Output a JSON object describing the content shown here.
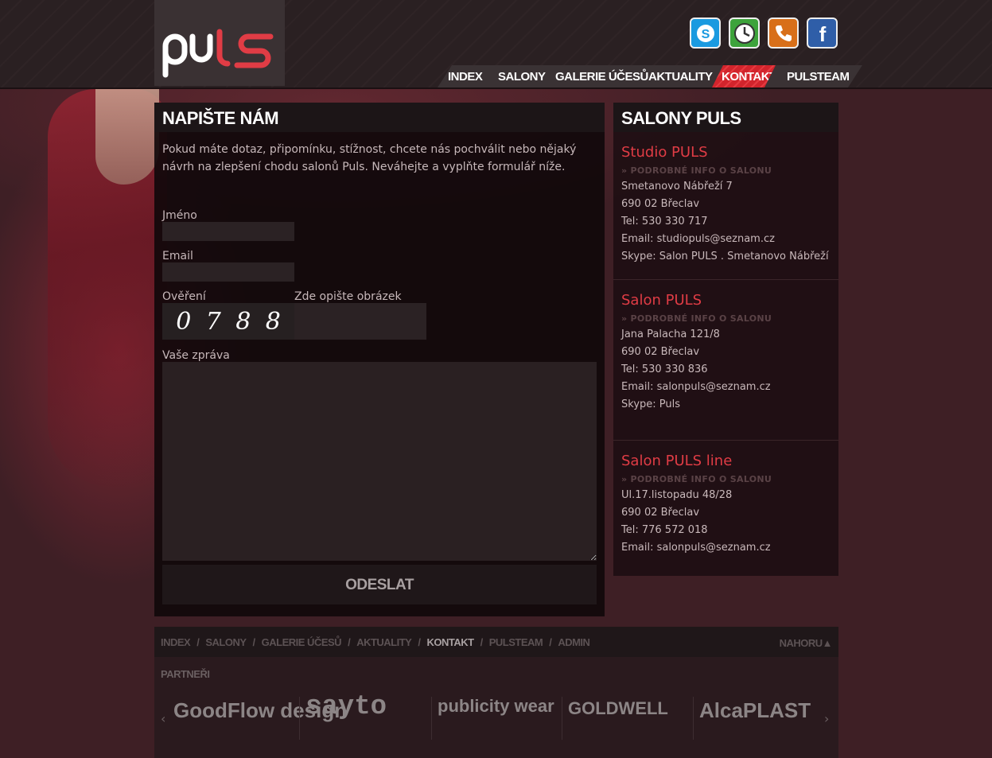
{
  "brand": {
    "logo_text": "puls"
  },
  "social": [
    "skype-icon",
    "clock-icon",
    "phone-icon",
    "facebook-icon"
  ],
  "nav": {
    "items": [
      "INDEX",
      "SALONY",
      "GALERIE ÚČESŮ",
      "AKTUALITY",
      "KONTAKT",
      "PULSTEAM"
    ],
    "active": "KONTAKT"
  },
  "form": {
    "title": "NAPIŠTE NÁM",
    "intro": "Pokud máte dotaz, připomínku, stížnost, chcete nás pochválit nebo nějaký návrh na zlepšení chodu salonů Puls. Neváhejte a vyplňte formulář níže.",
    "name_label": "Jméno",
    "email_label": "Email",
    "verify_label": "Ověření",
    "captcha_hint": "Zde opište obrázek",
    "captcha_digits": [
      "0",
      "7",
      "8",
      "8"
    ],
    "message_label": "Vaše zpráva",
    "submit": "ODESLAT"
  },
  "salons": {
    "title": "SALONY PULS",
    "more_label": "» PODROBNÉ INFO O SALONU",
    "list": [
      {
        "name": "Studio PULS",
        "lines": [
          "Smetanovo Nábřeží 7",
          "690 02 Břeclav",
          "Tel: 530 330 717",
          "Email: studiopuls@seznam.cz",
          "Skype: Salon PULS . Smetanovo Nábřeží"
        ]
      },
      {
        "name": "Salon PULS",
        "lines": [
          "Jana Palacha 121/8",
          "690 02 Břeclav",
          "Tel: 530 330 836",
          "Email: salonpuls@seznam.cz",
          "Skype: Puls"
        ]
      },
      {
        "name": "Salon PULS line",
        "lines": [
          "Ul.17.listopadu 48/28",
          "690 02 Břeclav",
          "Tel: 776 572 018",
          "Email: salonpuls@seznam.cz"
        ]
      }
    ]
  },
  "footer": {
    "nav": [
      "INDEX",
      "SALONY",
      "GALERIE ÚČESŮ",
      "AKTUALITY",
      "KONTAKT",
      "PULSTEAM",
      "ADMIN"
    ],
    "current": "KONTAKT",
    "top_link": "NAHORU▲",
    "partners_title": "PARTNEŘI",
    "partners": [
      "GoodFlow design",
      "sayto",
      "publicity wear",
      "GOLDWELL",
      "AlcaPLAST"
    ]
  },
  "colors": {
    "accent": "#e03c45",
    "nav_active": "#d2242c"
  }
}
